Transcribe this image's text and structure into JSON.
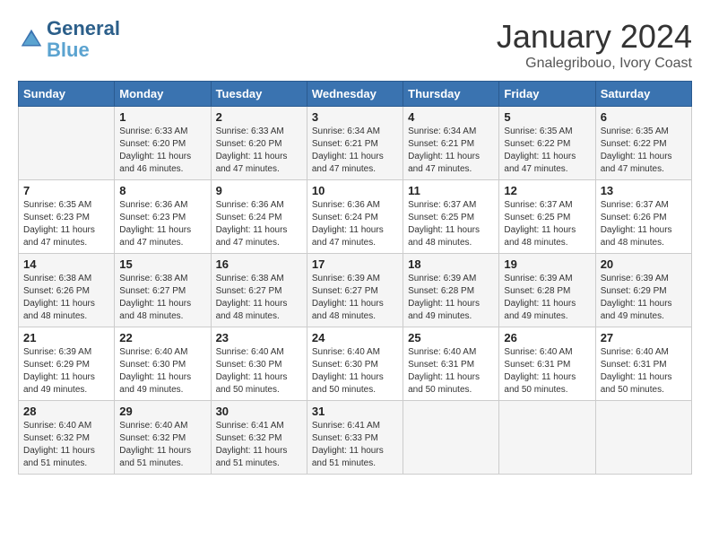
{
  "logo": {
    "line1": "General",
    "line2": "Blue"
  },
  "title": "January 2024",
  "subtitle": "Gnalegribouo, Ivory Coast",
  "headers": [
    "Sunday",
    "Monday",
    "Tuesday",
    "Wednesday",
    "Thursday",
    "Friday",
    "Saturday"
  ],
  "weeks": [
    [
      {
        "day": "",
        "sunrise": "",
        "sunset": "",
        "daylight": ""
      },
      {
        "day": "1",
        "sunrise": "Sunrise: 6:33 AM",
        "sunset": "Sunset: 6:20 PM",
        "daylight": "Daylight: 11 hours and 46 minutes."
      },
      {
        "day": "2",
        "sunrise": "Sunrise: 6:33 AM",
        "sunset": "Sunset: 6:20 PM",
        "daylight": "Daylight: 11 hours and 47 minutes."
      },
      {
        "day": "3",
        "sunrise": "Sunrise: 6:34 AM",
        "sunset": "Sunset: 6:21 PM",
        "daylight": "Daylight: 11 hours and 47 minutes."
      },
      {
        "day": "4",
        "sunrise": "Sunrise: 6:34 AM",
        "sunset": "Sunset: 6:21 PM",
        "daylight": "Daylight: 11 hours and 47 minutes."
      },
      {
        "day": "5",
        "sunrise": "Sunrise: 6:35 AM",
        "sunset": "Sunset: 6:22 PM",
        "daylight": "Daylight: 11 hours and 47 minutes."
      },
      {
        "day": "6",
        "sunrise": "Sunrise: 6:35 AM",
        "sunset": "Sunset: 6:22 PM",
        "daylight": "Daylight: 11 hours and 47 minutes."
      }
    ],
    [
      {
        "day": "7",
        "sunrise": "Sunrise: 6:35 AM",
        "sunset": "Sunset: 6:23 PM",
        "daylight": "Daylight: 11 hours and 47 minutes."
      },
      {
        "day": "8",
        "sunrise": "Sunrise: 6:36 AM",
        "sunset": "Sunset: 6:23 PM",
        "daylight": "Daylight: 11 hours and 47 minutes."
      },
      {
        "day": "9",
        "sunrise": "Sunrise: 6:36 AM",
        "sunset": "Sunset: 6:24 PM",
        "daylight": "Daylight: 11 hours and 47 minutes."
      },
      {
        "day": "10",
        "sunrise": "Sunrise: 6:36 AM",
        "sunset": "Sunset: 6:24 PM",
        "daylight": "Daylight: 11 hours and 47 minutes."
      },
      {
        "day": "11",
        "sunrise": "Sunrise: 6:37 AM",
        "sunset": "Sunset: 6:25 PM",
        "daylight": "Daylight: 11 hours and 48 minutes."
      },
      {
        "day": "12",
        "sunrise": "Sunrise: 6:37 AM",
        "sunset": "Sunset: 6:25 PM",
        "daylight": "Daylight: 11 hours and 48 minutes."
      },
      {
        "day": "13",
        "sunrise": "Sunrise: 6:37 AM",
        "sunset": "Sunset: 6:26 PM",
        "daylight": "Daylight: 11 hours and 48 minutes."
      }
    ],
    [
      {
        "day": "14",
        "sunrise": "Sunrise: 6:38 AM",
        "sunset": "Sunset: 6:26 PM",
        "daylight": "Daylight: 11 hours and 48 minutes."
      },
      {
        "day": "15",
        "sunrise": "Sunrise: 6:38 AM",
        "sunset": "Sunset: 6:27 PM",
        "daylight": "Daylight: 11 hours and 48 minutes."
      },
      {
        "day": "16",
        "sunrise": "Sunrise: 6:38 AM",
        "sunset": "Sunset: 6:27 PM",
        "daylight": "Daylight: 11 hours and 48 minutes."
      },
      {
        "day": "17",
        "sunrise": "Sunrise: 6:39 AM",
        "sunset": "Sunset: 6:27 PM",
        "daylight": "Daylight: 11 hours and 48 minutes."
      },
      {
        "day": "18",
        "sunrise": "Sunrise: 6:39 AM",
        "sunset": "Sunset: 6:28 PM",
        "daylight": "Daylight: 11 hours and 49 minutes."
      },
      {
        "day": "19",
        "sunrise": "Sunrise: 6:39 AM",
        "sunset": "Sunset: 6:28 PM",
        "daylight": "Daylight: 11 hours and 49 minutes."
      },
      {
        "day": "20",
        "sunrise": "Sunrise: 6:39 AM",
        "sunset": "Sunset: 6:29 PM",
        "daylight": "Daylight: 11 hours and 49 minutes."
      }
    ],
    [
      {
        "day": "21",
        "sunrise": "Sunrise: 6:39 AM",
        "sunset": "Sunset: 6:29 PM",
        "daylight": "Daylight: 11 hours and 49 minutes."
      },
      {
        "day": "22",
        "sunrise": "Sunrise: 6:40 AM",
        "sunset": "Sunset: 6:30 PM",
        "daylight": "Daylight: 11 hours and 49 minutes."
      },
      {
        "day": "23",
        "sunrise": "Sunrise: 6:40 AM",
        "sunset": "Sunset: 6:30 PM",
        "daylight": "Daylight: 11 hours and 50 minutes."
      },
      {
        "day": "24",
        "sunrise": "Sunrise: 6:40 AM",
        "sunset": "Sunset: 6:30 PM",
        "daylight": "Daylight: 11 hours and 50 minutes."
      },
      {
        "day": "25",
        "sunrise": "Sunrise: 6:40 AM",
        "sunset": "Sunset: 6:31 PM",
        "daylight": "Daylight: 11 hours and 50 minutes."
      },
      {
        "day": "26",
        "sunrise": "Sunrise: 6:40 AM",
        "sunset": "Sunset: 6:31 PM",
        "daylight": "Daylight: 11 hours and 50 minutes."
      },
      {
        "day": "27",
        "sunrise": "Sunrise: 6:40 AM",
        "sunset": "Sunset: 6:31 PM",
        "daylight": "Daylight: 11 hours and 50 minutes."
      }
    ],
    [
      {
        "day": "28",
        "sunrise": "Sunrise: 6:40 AM",
        "sunset": "Sunset: 6:32 PM",
        "daylight": "Daylight: 11 hours and 51 minutes."
      },
      {
        "day": "29",
        "sunrise": "Sunrise: 6:40 AM",
        "sunset": "Sunset: 6:32 PM",
        "daylight": "Daylight: 11 hours and 51 minutes."
      },
      {
        "day": "30",
        "sunrise": "Sunrise: 6:41 AM",
        "sunset": "Sunset: 6:32 PM",
        "daylight": "Daylight: 11 hours and 51 minutes."
      },
      {
        "day": "31",
        "sunrise": "Sunrise: 6:41 AM",
        "sunset": "Sunset: 6:33 PM",
        "daylight": "Daylight: 11 hours and 51 minutes."
      },
      {
        "day": "",
        "sunrise": "",
        "sunset": "",
        "daylight": ""
      },
      {
        "day": "",
        "sunrise": "",
        "sunset": "",
        "daylight": ""
      },
      {
        "day": "",
        "sunrise": "",
        "sunset": "",
        "daylight": ""
      }
    ]
  ]
}
